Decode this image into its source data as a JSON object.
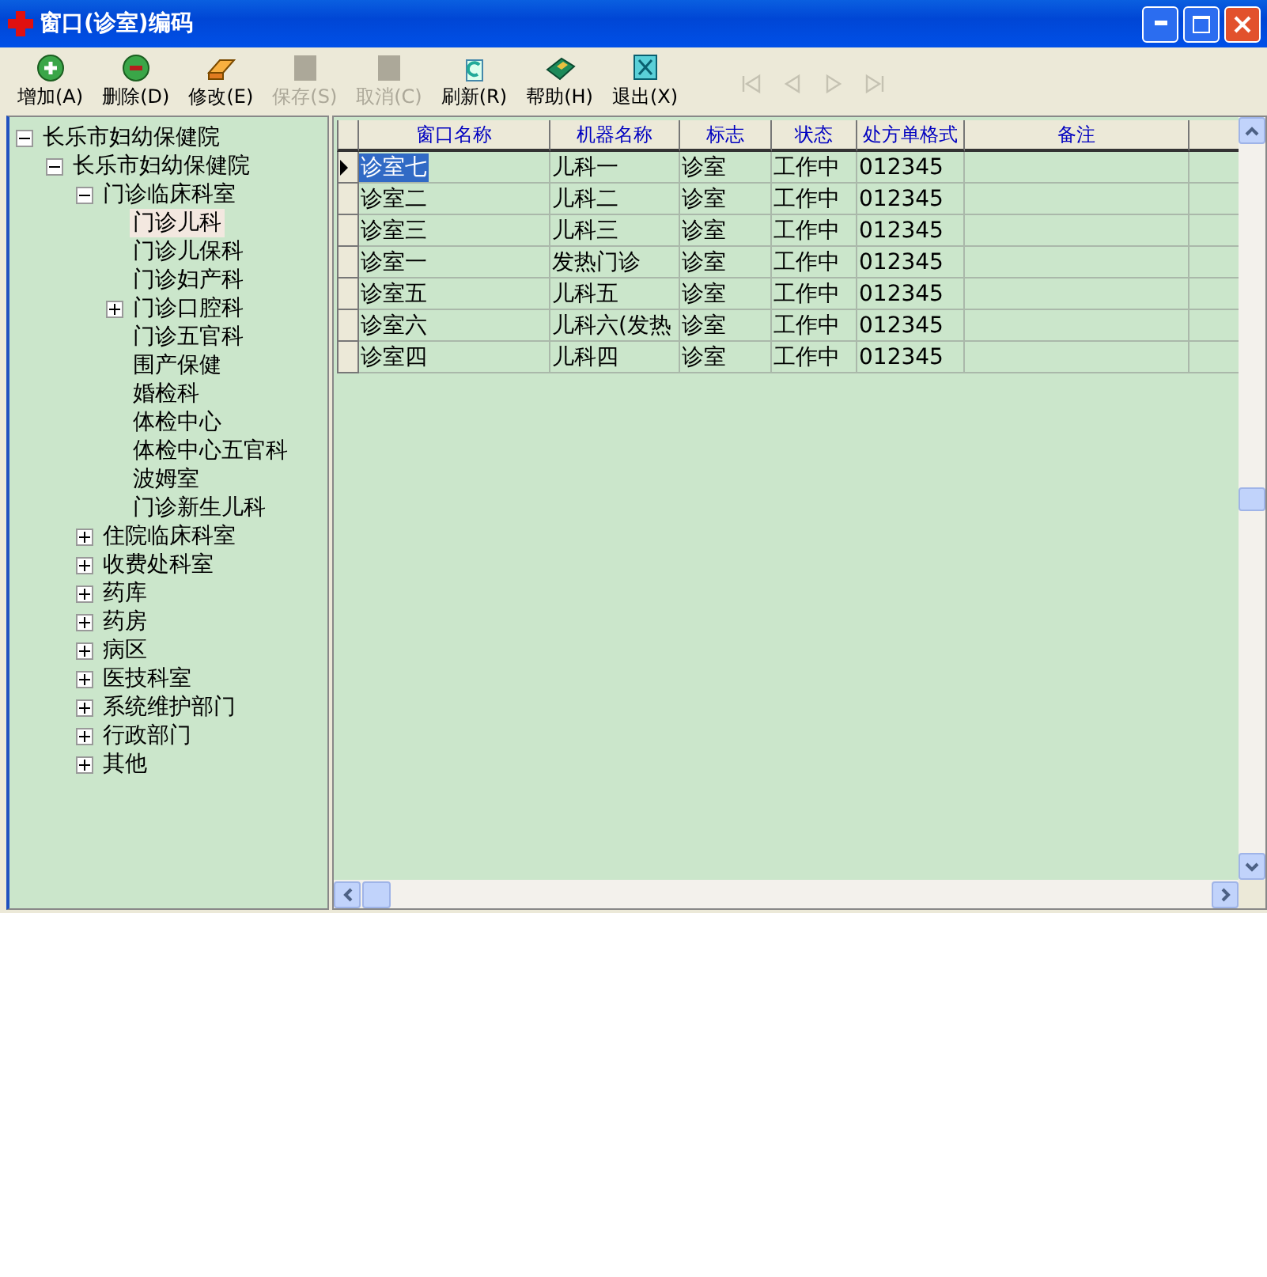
{
  "window": {
    "title": "窗口(诊室)编码"
  },
  "toolbar": [
    {
      "kind": "add",
      "label": "增加(A)",
      "disabled": false
    },
    {
      "kind": "delete",
      "label": "删除(D)",
      "disabled": false
    },
    {
      "kind": "edit",
      "label": "修改(E)",
      "disabled": false
    },
    {
      "kind": "save",
      "label": "保存(S)",
      "disabled": true
    },
    {
      "kind": "cancel",
      "label": "取消(C)",
      "disabled": true
    },
    {
      "kind": "refresh",
      "label": "刷新(R)",
      "disabled": false
    },
    {
      "kind": "help",
      "label": "帮助(H)",
      "disabled": false
    },
    {
      "kind": "exit",
      "label": "退出(X)",
      "disabled": false
    }
  ],
  "navigator": [
    {
      "kind": "first",
      "disabled": true
    },
    {
      "kind": "prev",
      "disabled": true
    },
    {
      "kind": "next",
      "disabled": true
    },
    {
      "kind": "last",
      "disabled": true
    }
  ],
  "tree": [
    {
      "label": "长乐市妇幼保健院",
      "expanded": true,
      "selected": false,
      "children": [
        {
          "label": "长乐市妇幼保健院",
          "expanded": true,
          "selected": false,
          "children": [
            {
              "label": "门诊临床科室",
              "expanded": true,
              "selected": false,
              "children": [
                {
                  "label": "门诊儿科",
                  "selected": true
                },
                {
                  "label": "门诊儿保科",
                  "selected": false
                },
                {
                  "label": "门诊妇产科",
                  "selected": false
                },
                {
                  "label": "门诊口腔科",
                  "expanded": false,
                  "selected": false
                },
                {
                  "label": "门诊五官科",
                  "selected": false
                },
                {
                  "label": "围产保健",
                  "selected": false
                },
                {
                  "label": "婚检科",
                  "selected": false
                },
                {
                  "label": "体检中心",
                  "selected": false
                },
                {
                  "label": "体检中心五官科",
                  "selected": false
                },
                {
                  "label": "波姆室",
                  "selected": false
                },
                {
                  "label": "门诊新生儿科",
                  "selected": false
                }
              ]
            },
            {
              "label": "住院临床科室",
              "expanded": false,
              "selected": false
            },
            {
              "label": "收费处科室",
              "expanded": false,
              "selected": false
            },
            {
              "label": "药库",
              "expanded": false,
              "selected": false
            },
            {
              "label": "药房",
              "expanded": false,
              "selected": false
            },
            {
              "label": "病区",
              "expanded": false,
              "selected": false
            },
            {
              "label": "医技科室",
              "expanded": false,
              "selected": false
            },
            {
              "label": "系统维护部门",
              "expanded": false,
              "selected": false
            },
            {
              "label": "行政部门",
              "expanded": false,
              "selected": false
            },
            {
              "label": "其他",
              "expanded": false,
              "selected": false
            }
          ]
        }
      ]
    }
  ],
  "table": {
    "columns": [
      "窗口名称",
      "机器名称",
      "标志",
      "状态",
      "处方单格式",
      "备注"
    ],
    "rows": [
      {
        "selected": true,
        "cells": [
          "诊室七",
          "儿科一",
          "诊室",
          "工作中",
          "012345"
        ]
      },
      {
        "selected": false,
        "cells": [
          "诊室二",
          "儿科二",
          "诊室",
          "工作中",
          "012345"
        ]
      },
      {
        "selected": false,
        "cells": [
          "诊室三",
          "儿科三",
          "诊室",
          "工作中",
          "012345"
        ]
      },
      {
        "selected": false,
        "cells": [
          "诊室一",
          "发热门诊",
          "诊室",
          "工作中",
          "012345"
        ]
      },
      {
        "selected": false,
        "cells": [
          "诊室五",
          "儿科五",
          "诊室",
          "工作中",
          "012345"
        ]
      },
      {
        "selected": false,
        "cells": [
          "诊室六",
          "儿科六(发热",
          "诊室",
          "工作中",
          "012345"
        ]
      },
      {
        "selected": false,
        "cells": [
          "诊室四",
          "儿科四",
          "诊室",
          "工作中",
          "012345"
        ]
      }
    ]
  }
}
